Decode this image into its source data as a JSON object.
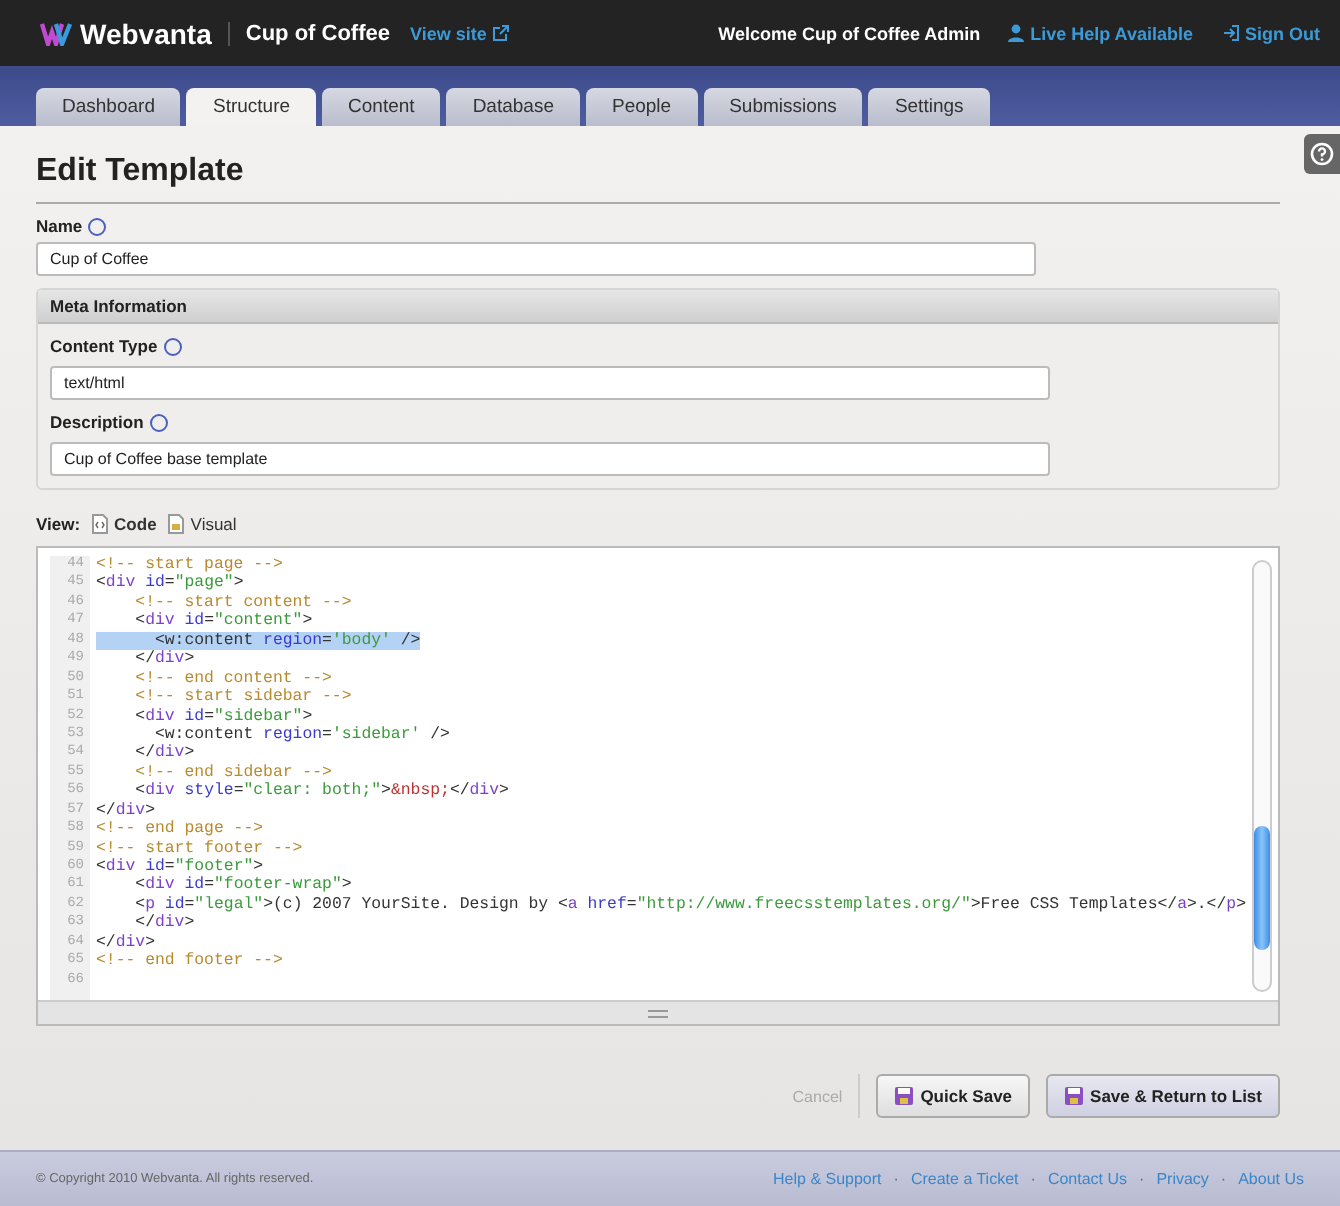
{
  "header": {
    "brand": "Webvanta",
    "site": "Cup of Coffee",
    "view_site": "View site",
    "welcome": "Welcome Cup of Coffee Admin",
    "live_help": "Live Help Available",
    "sign_out": "Sign Out"
  },
  "tabs": [
    {
      "label": "Dashboard",
      "selected": false
    },
    {
      "label": "Structure",
      "selected": true
    },
    {
      "label": "Content",
      "selected": false
    },
    {
      "label": "Database",
      "selected": false
    },
    {
      "label": "People",
      "selected": false
    },
    {
      "label": "Submissions",
      "selected": false
    },
    {
      "label": "Settings",
      "selected": false
    }
  ],
  "page_title": "Edit Template",
  "name_field": {
    "label": "Name",
    "value": "Cup of Coffee"
  },
  "meta": {
    "title": "Meta Information",
    "fields": [
      {
        "label": "Content Type",
        "value": "text/html"
      },
      {
        "label": "Description",
        "value": "Cup of Coffee base template"
      }
    ]
  },
  "view": {
    "label": "View:",
    "options": [
      {
        "label": "Code",
        "selected": true
      },
      {
        "label": "Visual",
        "selected": false
      }
    ]
  },
  "code_lines": [
    {
      "number": "44",
      "selected": false,
      "tokens": [
        {
          "kind": "comment",
          "text": "<!-- start page -->"
        }
      ]
    },
    {
      "number": "45",
      "selected": false,
      "tokens": [
        {
          "kind": "punct",
          "text": "<"
        },
        {
          "kind": "tag",
          "text": "div"
        },
        {
          "kind": "attr",
          "text": " id"
        },
        {
          "kind": "punct",
          "text": "="
        },
        {
          "kind": "string",
          "text": "\"page\""
        },
        {
          "kind": "punct",
          "text": ">"
        }
      ]
    },
    {
      "number": "46",
      "selected": false,
      "tokens": [
        {
          "kind": "comment",
          "text": "    <!-- start content -->"
        }
      ]
    },
    {
      "number": "47",
      "selected": false,
      "tokens": [
        {
          "kind": "punct",
          "text": "    <"
        },
        {
          "kind": "tag",
          "text": "div"
        },
        {
          "kind": "attr",
          "text": " id"
        },
        {
          "kind": "punct",
          "text": "="
        },
        {
          "kind": "string",
          "text": "\"content\""
        },
        {
          "kind": "punct",
          "text": ">"
        }
      ]
    },
    {
      "number": "48",
      "selected": true,
      "tokens": [
        {
          "kind": "punct",
          "text": "      <w:content"
        },
        {
          "kind": "attr",
          "text": " region"
        },
        {
          "kind": "punct",
          "text": "="
        },
        {
          "kind": "string",
          "text": "'body'"
        },
        {
          "kind": "punct",
          "text": " />"
        }
      ]
    },
    {
      "number": "49",
      "selected": false,
      "tokens": [
        {
          "kind": "punct",
          "text": "    </"
        },
        {
          "kind": "tag",
          "text": "div"
        },
        {
          "kind": "punct",
          "text": ">"
        }
      ]
    },
    {
      "number": "50",
      "selected": false,
      "tokens": [
        {
          "kind": "comment",
          "text": "    <!-- end content -->"
        }
      ]
    },
    {
      "number": "51",
      "selected": false,
      "tokens": [
        {
          "kind": "comment",
          "text": "    <!-- start sidebar -->"
        }
      ]
    },
    {
      "number": "52",
      "selected": false,
      "tokens": [
        {
          "kind": "punct",
          "text": "    <"
        },
        {
          "kind": "tag",
          "text": "div"
        },
        {
          "kind": "attr",
          "text": " id"
        },
        {
          "kind": "punct",
          "text": "="
        },
        {
          "kind": "string",
          "text": "\"sidebar\""
        },
        {
          "kind": "punct",
          "text": ">"
        }
      ]
    },
    {
      "number": "53",
      "selected": false,
      "tokens": [
        {
          "kind": "punct",
          "text": "      <w:content"
        },
        {
          "kind": "attr",
          "text": " region"
        },
        {
          "kind": "punct",
          "text": "="
        },
        {
          "kind": "string",
          "text": "'sidebar'"
        },
        {
          "kind": "punct",
          "text": " />"
        }
      ]
    },
    {
      "number": "54",
      "selected": false,
      "tokens": [
        {
          "kind": "punct",
          "text": "    </"
        },
        {
          "kind": "tag",
          "text": "div"
        },
        {
          "kind": "punct",
          "text": ">"
        }
      ]
    },
    {
      "number": "55",
      "selected": false,
      "tokens": [
        {
          "kind": "comment",
          "text": "    <!-- end sidebar -->"
        }
      ]
    },
    {
      "number": "56",
      "selected": false,
      "tokens": [
        {
          "kind": "punct",
          "text": "    <"
        },
        {
          "kind": "tag",
          "text": "div"
        },
        {
          "kind": "attr",
          "text": " style"
        },
        {
          "kind": "punct",
          "text": "="
        },
        {
          "kind": "string",
          "text": "\"clear: both;\""
        },
        {
          "kind": "punct",
          "text": ">"
        },
        {
          "kind": "entity",
          "text": "&nbsp;"
        },
        {
          "kind": "punct",
          "text": "</"
        },
        {
          "kind": "tag",
          "text": "div"
        },
        {
          "kind": "punct",
          "text": ">"
        }
      ]
    },
    {
      "number": "57",
      "selected": false,
      "tokens": [
        {
          "kind": "punct",
          "text": "</"
        },
        {
          "kind": "tag",
          "text": "div"
        },
        {
          "kind": "punct",
          "text": ">"
        }
      ]
    },
    {
      "number": "58",
      "selected": false,
      "tokens": [
        {
          "kind": "comment",
          "text": "<!-- end page -->"
        }
      ]
    },
    {
      "number": "59",
      "selected": false,
      "tokens": [
        {
          "kind": "comment",
          "text": "<!-- start footer -->"
        }
      ]
    },
    {
      "number": "60",
      "selected": false,
      "tokens": [
        {
          "kind": "punct",
          "text": "<"
        },
        {
          "kind": "tag",
          "text": "div"
        },
        {
          "kind": "attr",
          "text": " id"
        },
        {
          "kind": "punct",
          "text": "="
        },
        {
          "kind": "string",
          "text": "\"footer\""
        },
        {
          "kind": "punct",
          "text": ">"
        }
      ]
    },
    {
      "number": "61",
      "selected": false,
      "tokens": [
        {
          "kind": "punct",
          "text": "    <"
        },
        {
          "kind": "tag",
          "text": "div"
        },
        {
          "kind": "attr",
          "text": " id"
        },
        {
          "kind": "punct",
          "text": "="
        },
        {
          "kind": "string",
          "text": "\"footer-wrap\""
        },
        {
          "kind": "punct",
          "text": ">"
        }
      ]
    },
    {
      "number": "62",
      "selected": false,
      "tokens": [
        {
          "kind": "punct",
          "text": "    <"
        },
        {
          "kind": "tag",
          "text": "p"
        },
        {
          "kind": "attr",
          "text": " id"
        },
        {
          "kind": "punct",
          "text": "="
        },
        {
          "kind": "string",
          "text": "\"legal\""
        },
        {
          "kind": "punct",
          "text": ">(c) 2007 YourSite. Design by <"
        },
        {
          "kind": "tag",
          "text": "a"
        },
        {
          "kind": "attr",
          "text": " href"
        },
        {
          "kind": "punct",
          "text": "="
        },
        {
          "kind": "string",
          "text": "\"http://www.freecsstemplates.org/\""
        },
        {
          "kind": "punct",
          "text": ">Free CSS Templates</"
        },
        {
          "kind": "tag",
          "text": "a"
        },
        {
          "kind": "punct",
          "text": ">.</"
        },
        {
          "kind": "tag",
          "text": "p"
        },
        {
          "kind": "punct",
          "text": ">"
        }
      ]
    },
    {
      "number": "63",
      "selected": false,
      "tokens": [
        {
          "kind": "punct",
          "text": "    </"
        },
        {
          "kind": "tag",
          "text": "div"
        },
        {
          "kind": "punct",
          "text": ">"
        }
      ]
    },
    {
      "number": "64",
      "selected": false,
      "tokens": [
        {
          "kind": "punct",
          "text": "</"
        },
        {
          "kind": "tag",
          "text": "div"
        },
        {
          "kind": "punct",
          "text": ">"
        }
      ]
    },
    {
      "number": "65",
      "selected": false,
      "tokens": [
        {
          "kind": "comment",
          "text": "<!-- end footer -->"
        }
      ]
    },
    {
      "number": "66",
      "selected": false
    }
  ],
  "actions": {
    "cancel": "Cancel",
    "quick_save": "Quick Save",
    "save_return": "Save & Return to List"
  },
  "footer": {
    "copyright": "© Copyright 2010 Webvanta. All rights reserved.",
    "separator": "·",
    "links": [
      "Help & Support",
      "Create a Ticket",
      "Contact Us",
      "Privacy",
      "About Us"
    ]
  }
}
